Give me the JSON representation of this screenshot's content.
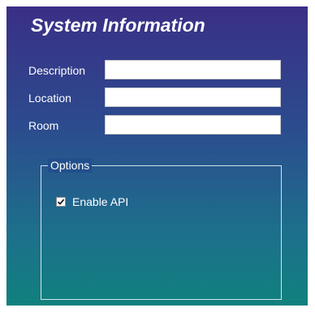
{
  "window": {
    "title": "System Information"
  },
  "fields": {
    "description": {
      "label": "Description",
      "value": "",
      "placeholder": ""
    },
    "location": {
      "label": "Location",
      "value": "",
      "placeholder": ""
    },
    "room": {
      "label": "Room",
      "value": "",
      "placeholder": ""
    }
  },
  "options": {
    "legend": "Options",
    "enable_api": {
      "label": "Enable API",
      "checked": true
    }
  },
  "colors": {
    "gradient_top": "#3a2f86",
    "gradient_bottom": "#10817e",
    "text": "#ffffff"
  },
  "icons": {
    "checkbox_mark": "check-icon"
  }
}
